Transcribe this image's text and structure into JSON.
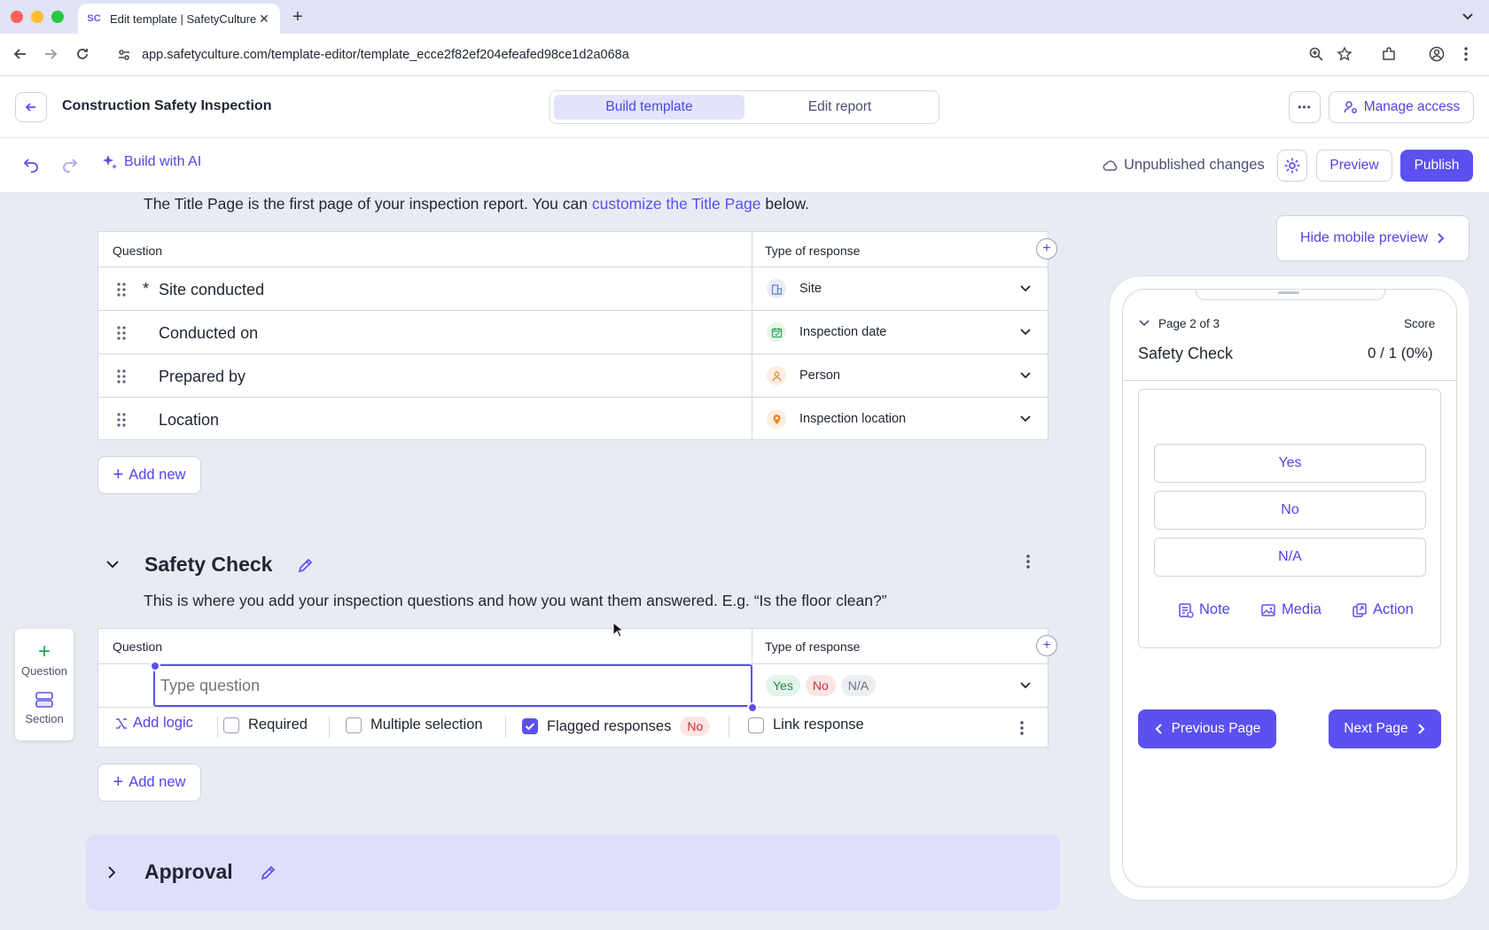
{
  "browser": {
    "tab_title": "Edit template | SafetyCulture",
    "url_host": "app.safetyculture.com",
    "url_path": "/template-editor/template_ecce2f82ef204efeafed98ce1d2a068a"
  },
  "header": {
    "template_title": "Construction Safety Inspection",
    "tabs": [
      {
        "label": "Build template",
        "active": true
      },
      {
        "label": "Edit report",
        "active": false
      }
    ],
    "more_label": "•••",
    "manage_access": "Manage access"
  },
  "toolbar": {
    "build_ai": "Build with AI",
    "status": "Unpublished changes",
    "preview": "Preview",
    "publish": "Publish"
  },
  "title_page": {
    "intro_text": "The Title Page is the first page of your inspection report. You can ",
    "intro_link": "customize the Title Page",
    "intro_end": " below.",
    "col_question": "Question",
    "col_response": "Type of response",
    "rows": [
      {
        "required": "*",
        "question": "Site conducted",
        "response": "Site",
        "icon": "site-icon"
      },
      {
        "required": "",
        "question": "Conducted on",
        "response": "Inspection date",
        "icon": "calendar-icon"
      },
      {
        "required": "",
        "question": "Prepared by",
        "response": "Person",
        "icon": "person-icon"
      },
      {
        "required": "",
        "question": "Location",
        "response": "Inspection location",
        "icon": "location-pin-icon"
      }
    ],
    "add_new": "Add new"
  },
  "safety_section": {
    "title": "Safety Check",
    "description": "This is where you add your inspection questions and how you want them answered. E.g. “Is the floor clean?”",
    "col_question": "Question",
    "col_response": "Type of response",
    "question_placeholder": "Type question",
    "responses": [
      "Yes",
      "No",
      "N/A"
    ],
    "add_logic": "Add logic",
    "options": [
      {
        "label": "Required",
        "checked": false
      },
      {
        "label": "Multiple selection",
        "checked": false
      },
      {
        "label": "Flagged responses",
        "checked": true
      },
      {
        "label": "Link response",
        "checked": false
      }
    ],
    "flagged_value": "No",
    "add_new": "Add new"
  },
  "approval_section": {
    "title": "Approval"
  },
  "palette": {
    "question": "Question",
    "section": "Section"
  },
  "mobile_preview": {
    "hide_label": "Hide mobile preview",
    "page_label": "Page 2 of 3",
    "score_label": "Score",
    "section_title": "Safety Check",
    "score_value": "0 / 1 (0%)",
    "answers": [
      "Yes",
      "No",
      "N/A"
    ],
    "actions": [
      "Note",
      "Media",
      "Action"
    ],
    "prev_page": "Previous Page",
    "next_page": "Next Page"
  },
  "colors": {
    "accent": "#5b50f0",
    "yes_bg": "#e3f5ea",
    "no_bg": "#fde4e4",
    "na_bg": "#eceef2"
  }
}
